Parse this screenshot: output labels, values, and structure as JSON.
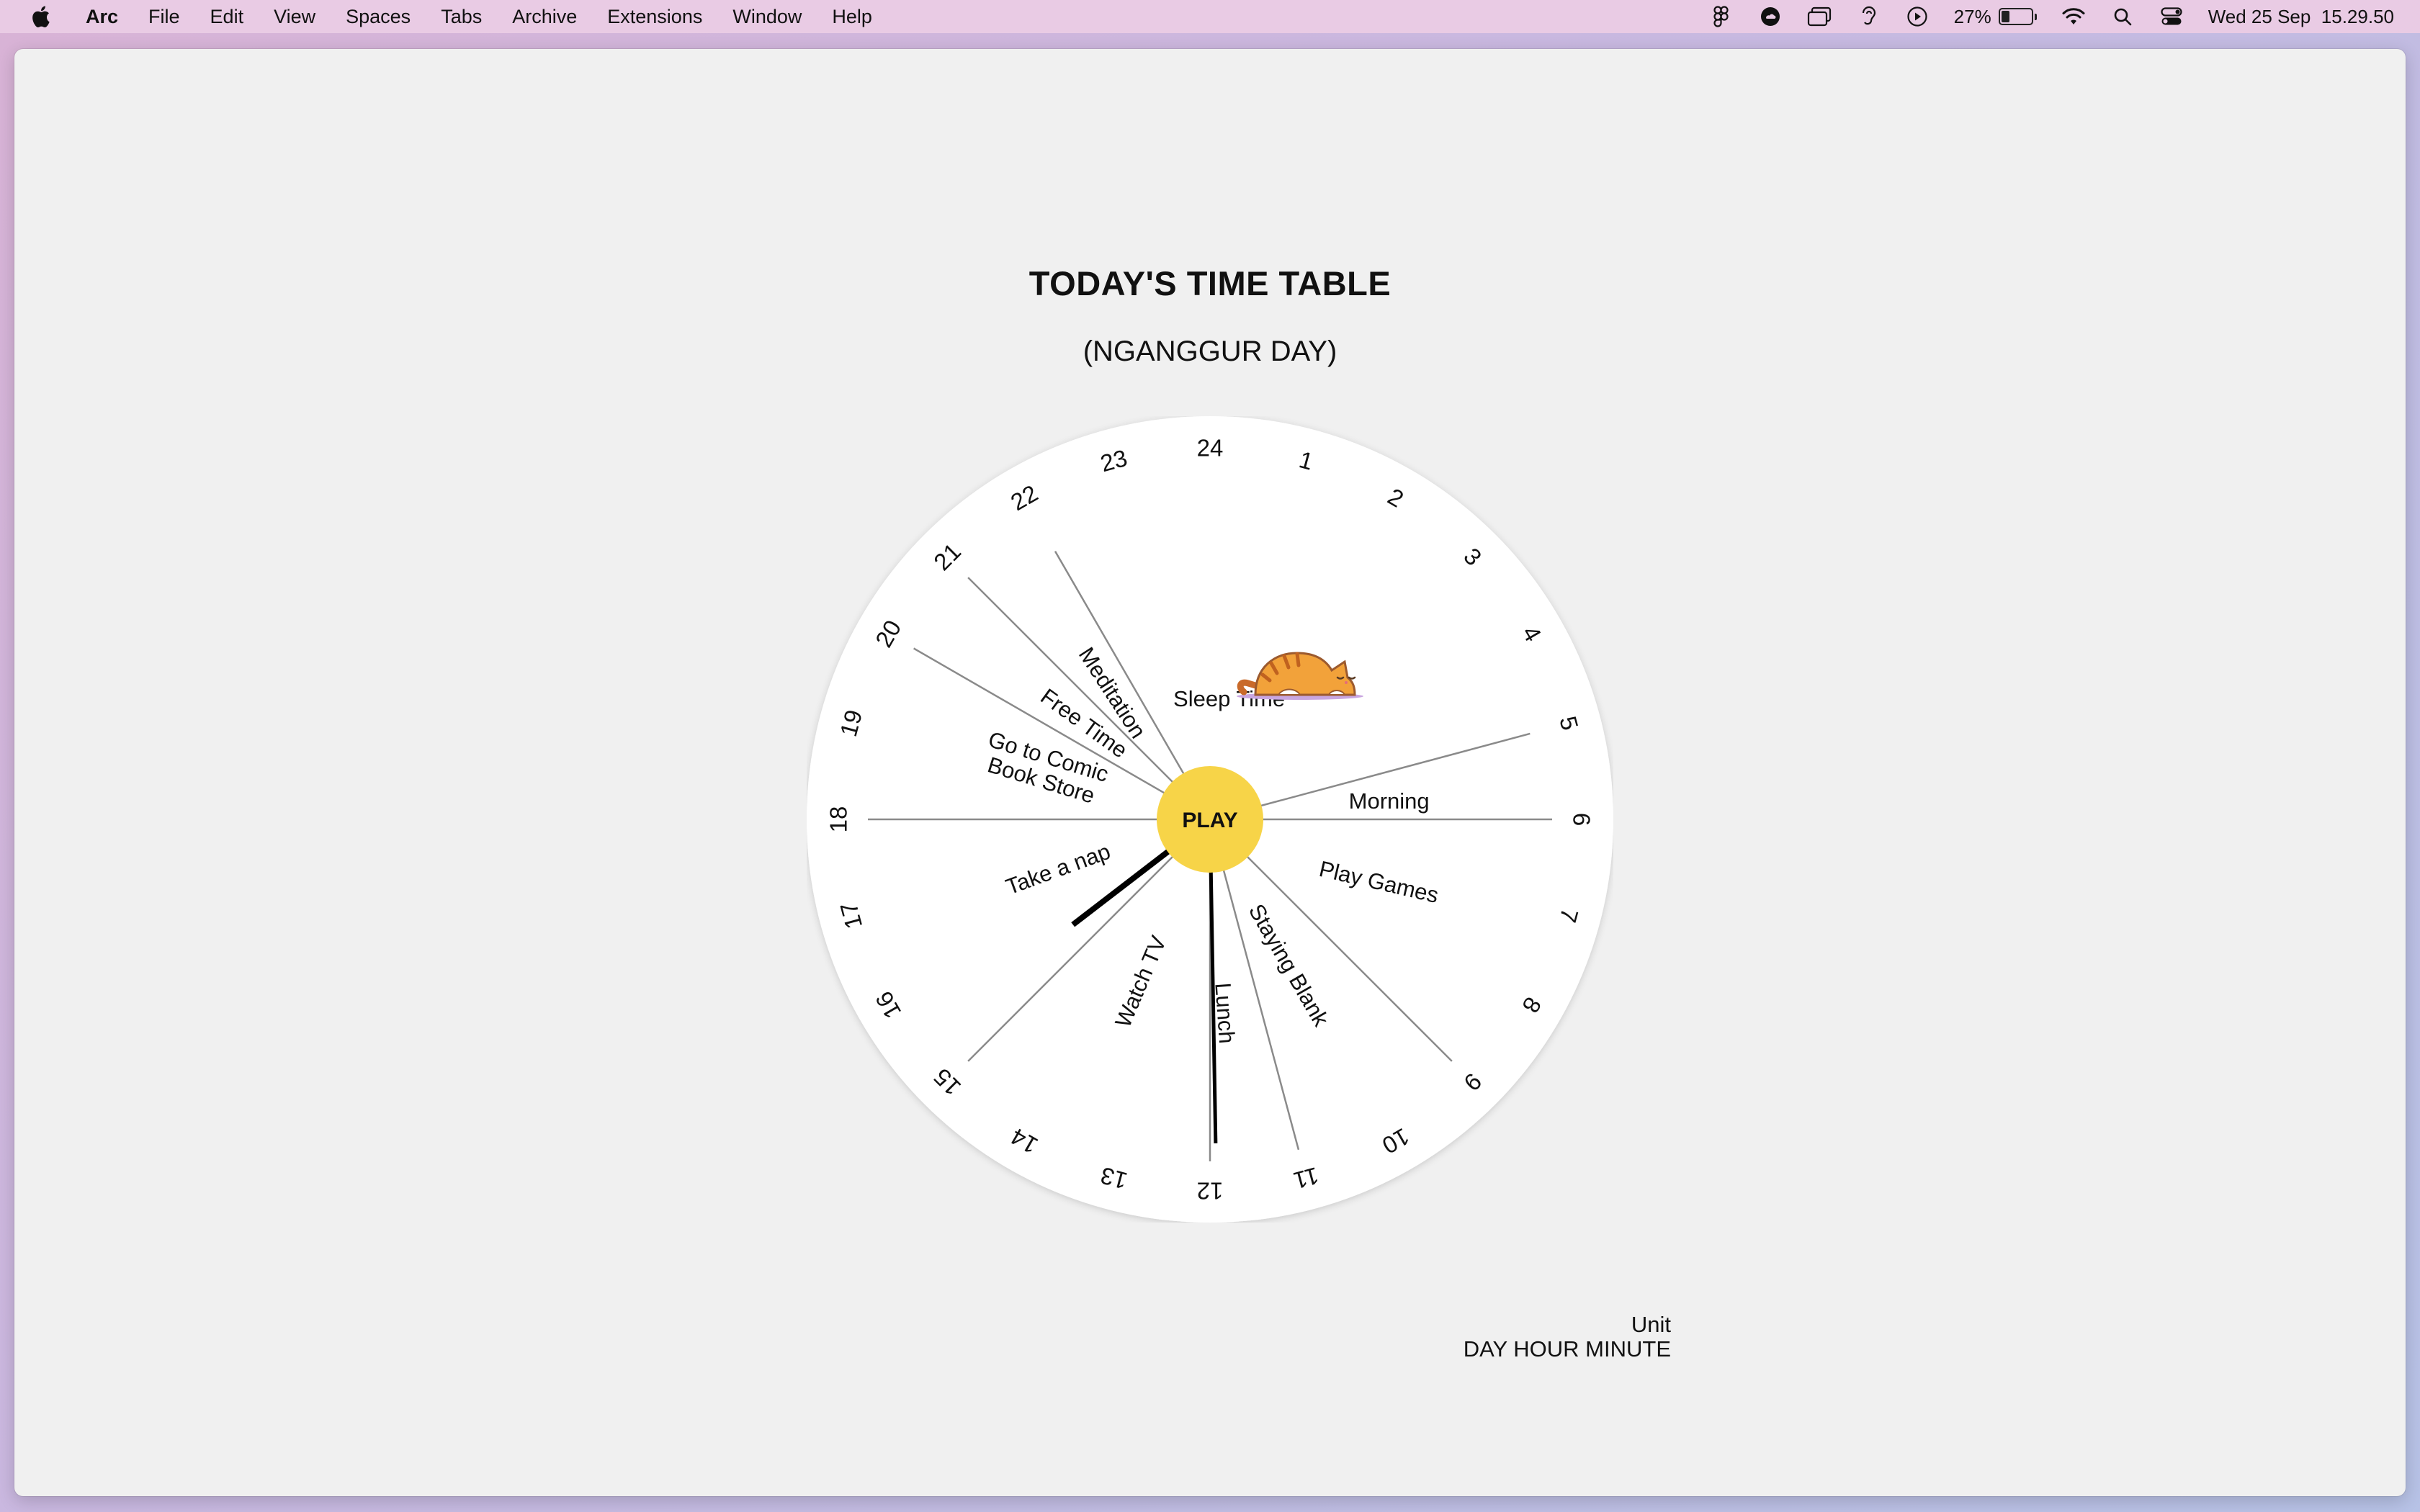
{
  "menubar": {
    "apple_icon": "apple-logo-icon",
    "app_name": "Arc",
    "items": [
      "File",
      "Edit",
      "View",
      "Spaces",
      "Tabs",
      "Archive",
      "Extensions",
      "Window",
      "Help"
    ],
    "status": {
      "icons": [
        "figma-icon",
        "creative-cloud-icon",
        "window-stack-icon",
        "hearing-icon",
        "play-circle-icon"
      ],
      "battery_percent": "27%",
      "battery_level": 0.27,
      "wifi_icon": "wifi-icon",
      "search_icon": "search-icon",
      "control_center_icon": "control-center-icon",
      "datetime": "Wed 25 Sep  15.29.50"
    }
  },
  "page": {
    "title": "TODAY'S TIME TABLE",
    "subtitle": "(NGANGGUR DAY)",
    "play_button": "PLAY",
    "unit_label": "Unit",
    "unit_value": "DAY HOUR MINUTE",
    "sleeping_cat_icon": "sleeping-cat-icon"
  },
  "schedule": {
    "hour_labels": [
      "24",
      "1",
      "2",
      "3",
      "4",
      "5",
      "6",
      "7",
      "8",
      "9",
      "10",
      "11",
      "12",
      "13",
      "14",
      "15",
      "16",
      "17",
      "18",
      "19",
      "20",
      "21",
      "22",
      "23"
    ],
    "activities": [
      {
        "label": "Sleep Time",
        "start": 22,
        "end": 29
      },
      {
        "label": "Morning",
        "start": 5,
        "end": 6
      },
      {
        "label": "Play Games",
        "start": 6,
        "end": 9
      },
      {
        "label": "Staying Blank",
        "start": 9,
        "end": 11
      },
      {
        "label": "Lunch",
        "start": 11,
        "end": 12
      },
      {
        "label": "Watch TV",
        "start": 12,
        "end": 15
      },
      {
        "label": "Take a nap",
        "start": 15,
        "end": 18
      },
      {
        "label": "Go to Comic Book Store",
        "start": 18,
        "end": 20
      },
      {
        "label": "Free Time",
        "start": 20,
        "end": 21
      },
      {
        "label": "Meditation",
        "start": 21,
        "end": 22
      }
    ],
    "current_time": "15.29.50",
    "colors": {
      "dial": "#ffffff",
      "play": "#f7d448",
      "hand": "#000000",
      "divider": "#8a8a8a"
    }
  }
}
